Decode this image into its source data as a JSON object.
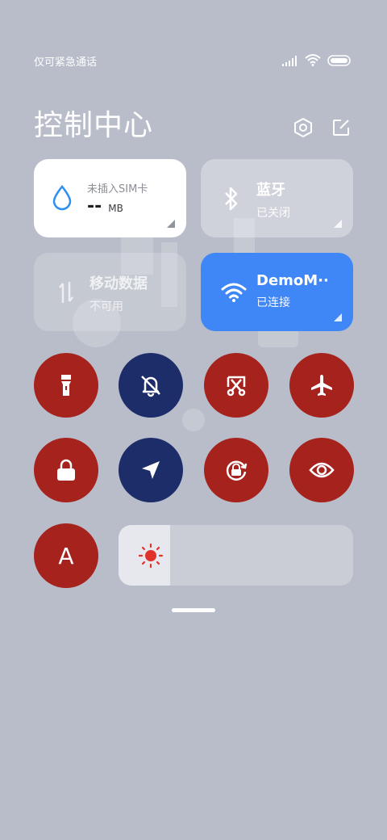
{
  "status_bar": {
    "carrier_text": "仅可紧急通话"
  },
  "header": {
    "title": "控制中心"
  },
  "cards": {
    "data_usage": {
      "label": "未插入SIM卡",
      "value": "--",
      "unit": "MB"
    },
    "bluetooth": {
      "label": "蓝牙",
      "status": "已关闭"
    },
    "mobile_data": {
      "label": "移动数据",
      "status": "不可用"
    },
    "wifi": {
      "label": "DemoM··",
      "status": "已连接"
    }
  },
  "toggles": [
    {
      "icon": "flashlight-icon",
      "state": "on",
      "color": "#a6221d"
    },
    {
      "icon": "mute-bell-icon",
      "state": "off",
      "color": "#1c2d6a"
    },
    {
      "icon": "screenshot-icon",
      "state": "on",
      "color": "#a6221d"
    },
    {
      "icon": "airplane-icon",
      "state": "on",
      "color": "#a6221d"
    },
    {
      "icon": "lock-icon",
      "state": "on",
      "color": "#a6221d"
    },
    {
      "icon": "location-icon",
      "state": "off",
      "color": "#1c2d6a"
    },
    {
      "icon": "rotation-lock-icon",
      "state": "on",
      "color": "#a6221d"
    },
    {
      "icon": "eye-comfort-icon",
      "state": "on",
      "color": "#a6221d"
    },
    {
      "icon": "auto-brightness-icon",
      "state": "on",
      "color": "#a6221d",
      "label": "A"
    }
  ],
  "brightness": {
    "level": 0.22
  },
  "colors": {
    "wifi_card": "#3f86f6",
    "toggle_on": "#a6221d",
    "toggle_off": "#1c2d6a",
    "background": "#b9bdc9"
  }
}
